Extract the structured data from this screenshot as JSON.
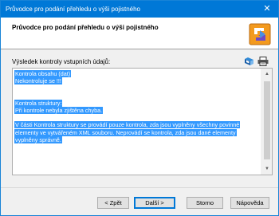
{
  "window": {
    "title": "Průvodce pro  podání přehledu o výši pojistného",
    "close_glyph": "✕"
  },
  "header": {
    "title": "Průvodce pro  podání přehledu o výši pojistného"
  },
  "main": {
    "section_label": "Výsledek kontroly vstupních údajů:",
    "tool_icons": [
      "save-icon",
      "print-icon"
    ],
    "result_lines": [
      "Kontrola obsahu (dat)",
      "Nekontroluje se !!!",
      "",
      "Kontrola struktury:",
      "Při kontrole nebyla zjištěna chyba.",
      "",
      "V části Kontrola struktury se provádí pouze kontrola, zda jsou vyplněny všechny povinné",
      "elementy ve vytvářeném XML souboru. Neprovádí se kontrola, zda jsou dané elementy",
      "vyplněny správně."
    ]
  },
  "buttons": {
    "back": "< Zpět",
    "next": "Další >",
    "cancel": "Storno",
    "help": "Nápověda"
  },
  "colors": {
    "titlebar": "#0078d7",
    "selection": "#3399ff"
  }
}
